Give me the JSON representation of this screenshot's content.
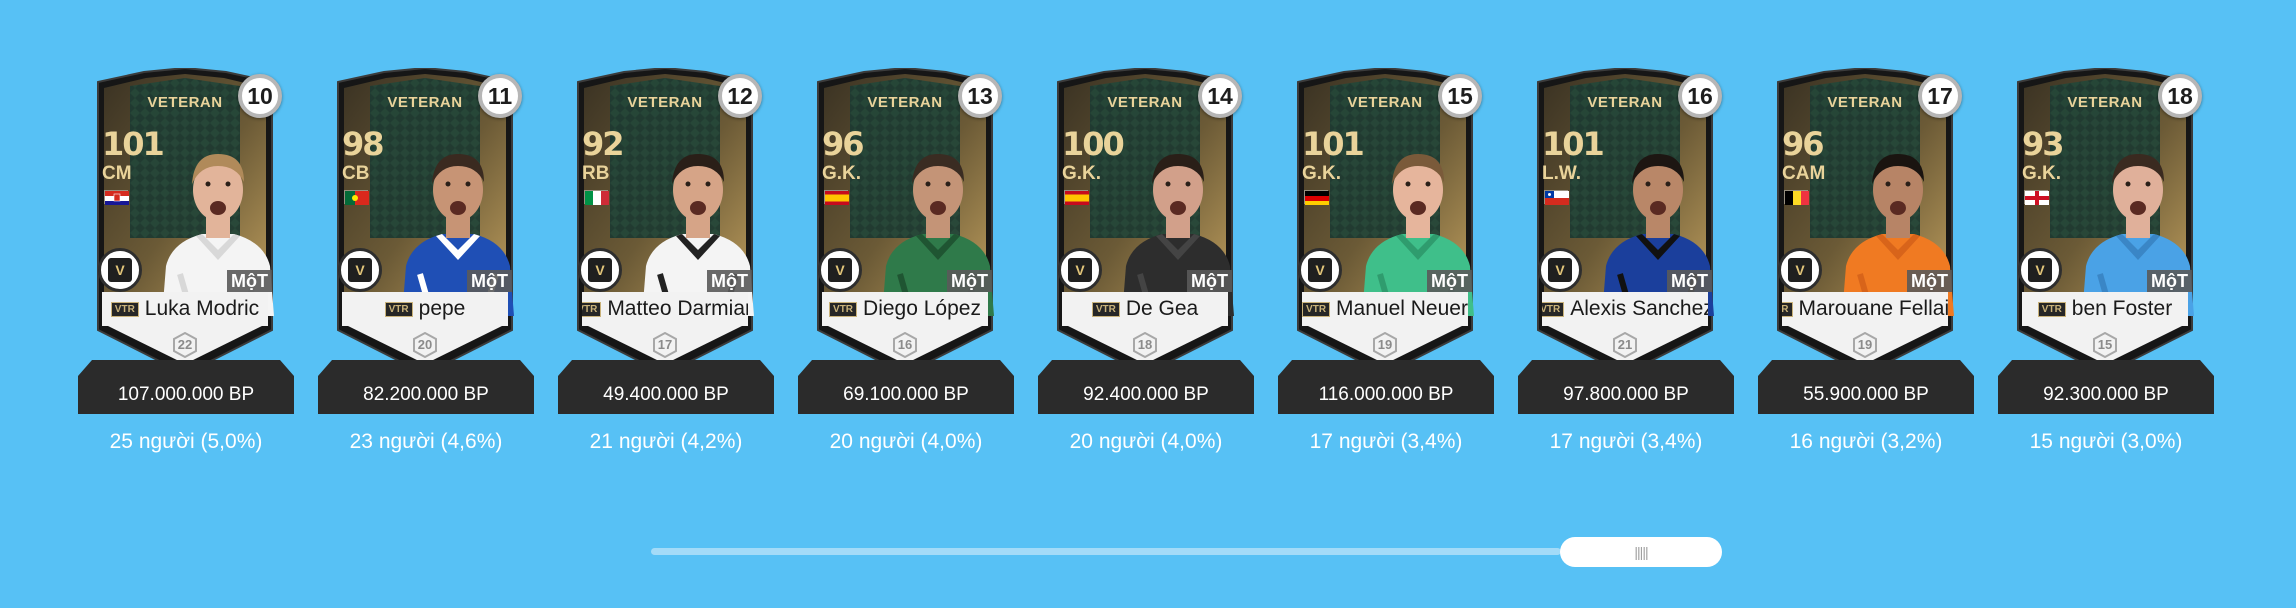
{
  "cards": [
    {
      "rank": "10",
      "tier": "VETERAN",
      "ovr": "101",
      "pos": "CM",
      "flag": "croatia",
      "season": "VTR",
      "name": "Luka Modric",
      "level": "22",
      "brand": "MộT",
      "price": "107.000.000 BP",
      "usage": "25 người (5,0%)",
      "kit": "#f4f4f4",
      "kit2": "#d8d8d8",
      "skin": "#e2b49a",
      "hair": "#b08a5a"
    },
    {
      "rank": "11",
      "tier": "VETERAN",
      "ovr": "98",
      "pos": "CB",
      "flag": "portugal",
      "season": "VTR",
      "name": "pepe",
      "level": "20",
      "brand": "MộT",
      "price": "82.200.000 BP",
      "usage": "23 người (4,6%)",
      "kit": "#1f4fb5",
      "kit2": "#ffffff",
      "skin": "#c79475",
      "hair": "#3a2a20"
    },
    {
      "rank": "12",
      "tier": "VETERAN",
      "ovr": "92",
      "pos": "RB",
      "flag": "italy",
      "season": "VTR",
      "name": "Matteo Darmian",
      "level": "17",
      "brand": "MộT",
      "price": "49.400.000 BP",
      "usage": "21 người (4,2%)",
      "kit": "#f4f4f4",
      "kit2": "#222222",
      "skin": "#d6a487",
      "hair": "#2a1f18"
    },
    {
      "rank": "13",
      "tier": "VETERAN",
      "ovr": "96",
      "pos": "G.K.",
      "flag": "spain",
      "season": "VTR",
      "name": "Diego López",
      "level": "16",
      "brand": "MộT",
      "price": "69.100.000 BP",
      "usage": "20 người (4,0%)",
      "kit": "#2f7a4a",
      "kit2": "#1f5532",
      "skin": "#c49477",
      "hair": "#3a2c22"
    },
    {
      "rank": "14",
      "tier": "VETERAN",
      "ovr": "100",
      "pos": "G.K.",
      "flag": "spain",
      "season": "VTR",
      "name": "De Gea",
      "level": "18",
      "brand": "MộT",
      "price": "92.400.000 BP",
      "usage": "20 người (4,0%)",
      "kit": "#2d2d2d",
      "kit2": "#444444",
      "skin": "#d2a08a",
      "hair": "#2a1f18"
    },
    {
      "rank": "15",
      "tier": "VETERAN",
      "ovr": "101",
      "pos": "G.K.",
      "flag": "germany",
      "season": "VTR",
      "name": "Manuel Neuer",
      "level": "19",
      "brand": "MộT",
      "price": "116.000.000 BP",
      "usage": "17 người (3,4%)",
      "kit": "#3fbf8a",
      "kit2": "#2f9c6e",
      "skin": "#e6b59c",
      "hair": "#7a5a3a"
    },
    {
      "rank": "16",
      "tier": "VETERAN",
      "ovr": "101",
      "pos": "L.W.",
      "flag": "chile",
      "season": "VTR",
      "name": "Alexis Sanchez",
      "level": "21",
      "brand": "MộT",
      "price": "97.800.000 BP",
      "usage": "17 người (3,4%)",
      "kit": "#1b3f9c",
      "kit2": "#111111",
      "skin": "#b98768",
      "hair": "#1d1612"
    },
    {
      "rank": "17",
      "tier": "VETERAN",
      "ovr": "96",
      "pos": "CAM",
      "flag": "belgium",
      "season": "VTR",
      "name": "Marouane Fellaini",
      "level": "19",
      "brand": "MộT",
      "price": "55.900.000 BP",
      "usage": "16 người (3,2%)",
      "kit": "#f07a22",
      "kit2": "#d8641a",
      "skin": "#b78466",
      "hair": "#1a1410"
    },
    {
      "rank": "18",
      "tier": "VETERAN",
      "ovr": "93",
      "pos": "G.K.",
      "flag": "england",
      "season": "VTR",
      "name": "ben Foster",
      "level": "15",
      "brand": "MộT",
      "price": "92.300.000 BP",
      "usage": "15 người (3,0%)",
      "kit": "#4aa2e6",
      "kit2": "#3a86c6",
      "skin": "#e0b09a",
      "hair": "#3a2a20"
    }
  ],
  "scrollbar": {
    "grip": "|||||"
  }
}
